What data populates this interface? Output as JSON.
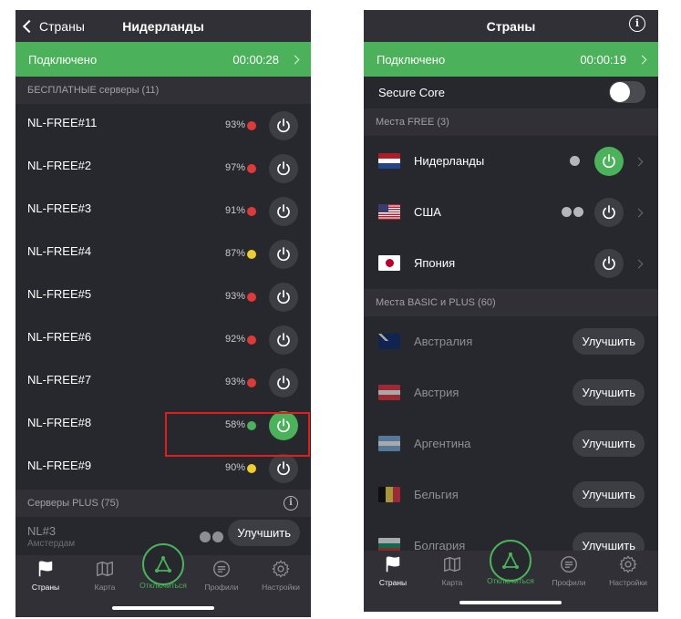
{
  "left": {
    "nav": {
      "back_label": "Страны",
      "title": "Нидерланды"
    },
    "connection": {
      "status": "Подключено",
      "time": "00:00:28"
    },
    "free_section": "БЕСПЛАТНЫЕ серверы (11)",
    "servers": [
      {
        "name": "NL-FREE#11",
        "load": "93%",
        "load_color": "#dd3a3a"
      },
      {
        "name": "NL-FREE#2",
        "load": "97%",
        "load_color": "#dd3a3a"
      },
      {
        "name": "NL-FREE#3",
        "load": "91%",
        "load_color": "#dd3a3a"
      },
      {
        "name": "NL-FREE#4",
        "load": "87%",
        "load_color": "#efcd30"
      },
      {
        "name": "NL-FREE#5",
        "load": "93%",
        "load_color": "#dd3a3a"
      },
      {
        "name": "NL-FREE#6",
        "load": "92%",
        "load_color": "#dd3a3a"
      },
      {
        "name": "NL-FREE#7",
        "load": "93%",
        "load_color": "#dd3a3a"
      },
      {
        "name": "NL-FREE#8",
        "load": "58%",
        "load_color": "#4cb15b",
        "connected": true
      },
      {
        "name": "NL-FREE#9",
        "load": "90%",
        "load_color": "#efcd30"
      }
    ],
    "plus_section": "Серверы PLUS (75)",
    "plus_server": {
      "name": "NL#3",
      "sub": "Амстердам",
      "upgrade": "Улучшить"
    }
  },
  "right": {
    "nav": {
      "title": "Страны"
    },
    "connection": {
      "status": "Подключено",
      "time": "00:00:19"
    },
    "secure_core": "Secure Core",
    "free_section": "Места FREE (3)",
    "free_countries": [
      {
        "name": "Нидерланды",
        "connected": true
      },
      {
        "name": "США",
        "connected": false
      },
      {
        "name": "Япония",
        "connected": false
      }
    ],
    "basic_section": "Места BASIC и PLUS (60)",
    "basic_countries": [
      {
        "name": "Австралия",
        "upgrade": "Улучшить"
      },
      {
        "name": "Австрия",
        "upgrade": "Улучшить"
      },
      {
        "name": "Аргентина",
        "upgrade": "Улучшить"
      },
      {
        "name": "Бельгия",
        "upgrade": "Улучшить"
      },
      {
        "name": "Болгария",
        "upgrade": "Улучшить"
      }
    ]
  },
  "tabs": {
    "countries": "Страны",
    "map": "Карта",
    "disconnect": "Отключиться",
    "profiles": "Профили",
    "settings": "Настройки"
  },
  "colors": {
    "accent": "#4cb15b",
    "background": "#27282d",
    "highlight": "#e11d1d"
  }
}
